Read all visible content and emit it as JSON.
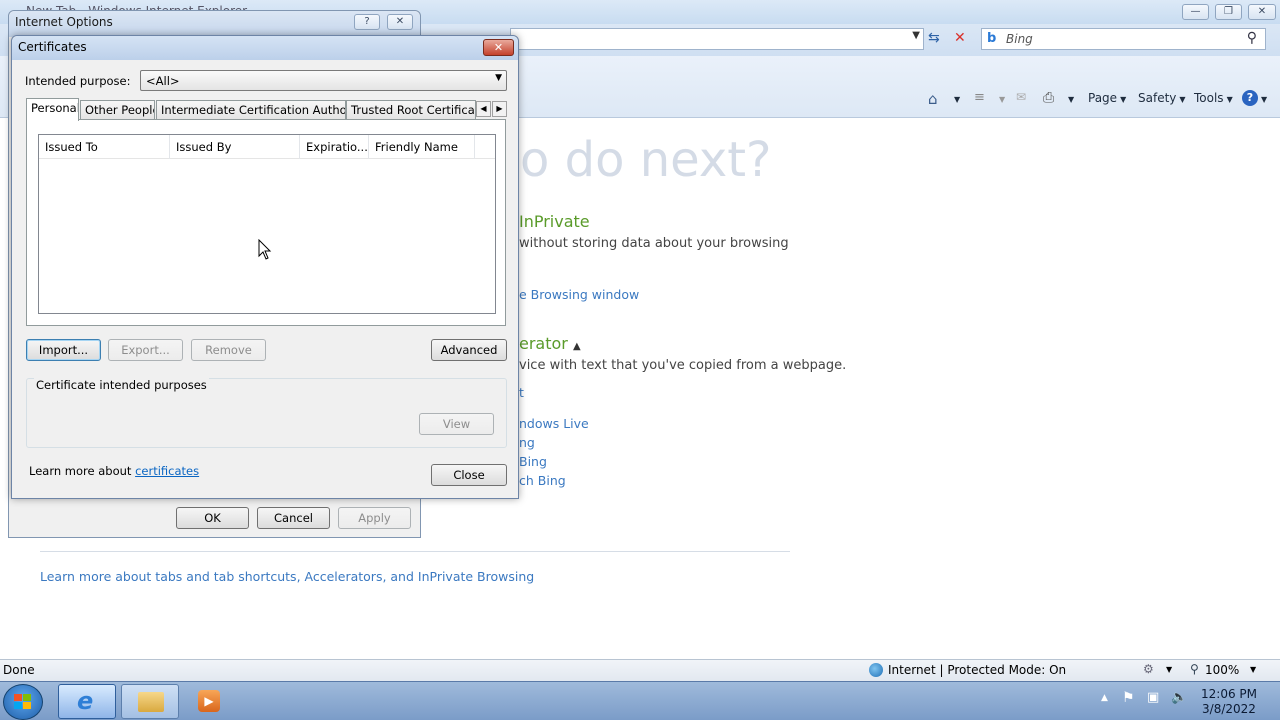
{
  "browser": {
    "window_title": "New Tab - Windows Internet Explorer",
    "search_placeholder": "Bing",
    "commands": {
      "page": "Page",
      "safety": "Safety",
      "tools": "Tools"
    },
    "content": {
      "heading": "o do next?",
      "inprivate_heading": "InPrivate",
      "inprivate_text": "without storing data about your browsing",
      "inprivate_link": "e Browsing window",
      "accelerator_heading": "erator",
      "accelerator_text": "vice with text that you've copied from a webpage.",
      "acc_links": [
        "t",
        "ndows Live",
        "ng",
        "Bing",
        "ch Bing"
      ],
      "learn_more": "Learn more about tabs and tab shortcuts, Accelerators, and InPrivate Browsing"
    },
    "status": {
      "left": "Done",
      "zone": "Internet | Protected Mode: On",
      "zoom": "100%"
    }
  },
  "taskbar": {
    "time": "12:06 PM",
    "date": "3/8/2022"
  },
  "internet_options": {
    "title": "Internet Options",
    "buttons": {
      "ok": "OK",
      "cancel": "Cancel",
      "apply": "Apply"
    }
  },
  "certificates": {
    "title": "Certificates",
    "purpose_label": "Intended purpose:",
    "purpose_value": "<All>",
    "tabs": [
      "Personal",
      "Other People",
      "Intermediate Certification Authorities",
      "Trusted Root Certification"
    ],
    "columns": [
      "Issued To",
      "Issued By",
      "Expiratio...",
      "Friendly Name"
    ],
    "rows": [],
    "buttons": {
      "import": "Import...",
      "export": "Export...",
      "remove": "Remove",
      "advanced": "Advanced",
      "view": "View",
      "close": "Close"
    },
    "group_label": "Certificate intended purposes",
    "learn_prefix": "Learn more about ",
    "learn_link": "certificates"
  },
  "colors": {
    "accent_green": "#5a9b2a",
    "link_blue": "#3b79c1",
    "close_red": "#c4412b"
  }
}
